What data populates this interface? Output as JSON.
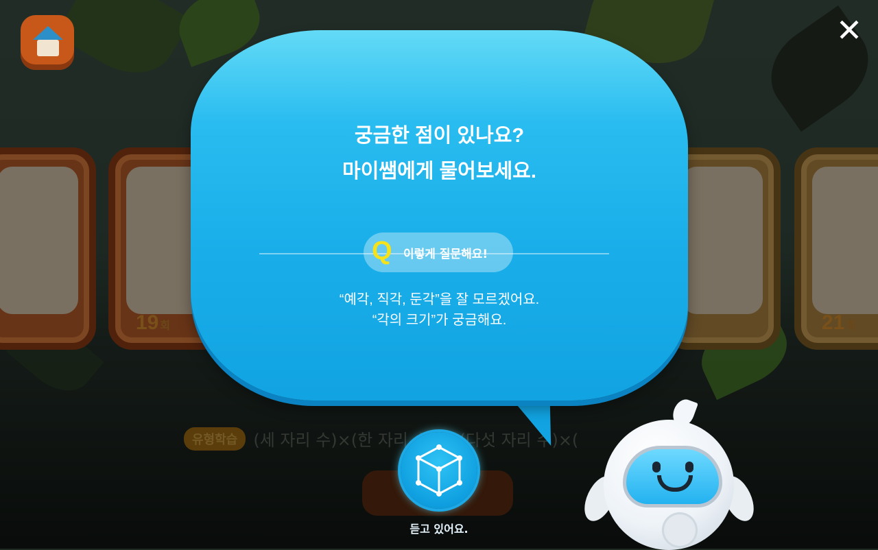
{
  "header": {
    "home_icon": "home-icon",
    "close_icon": "close-icon",
    "close_glyph": "✕"
  },
  "cards": [
    {
      "number": "",
      "unit": ""
    },
    {
      "number": "19",
      "unit": "회"
    },
    {
      "number": "",
      "unit": ""
    },
    {
      "number": "21",
      "unit": "회"
    }
  ],
  "bubble": {
    "title_line1": "궁금한 점이 있나요?",
    "title_line2": "마이쌤에게 물어보세요.",
    "q_letter": "Q",
    "q_label": "이렇게 질문해요!",
    "example_line1": "“예각, 직각, 둔각”을 잘 모르겠어요.",
    "example_line2": "“각의 크기”가 궁금해요."
  },
  "caption": {
    "tag": "유형학습",
    "math": "(세 자리 수)×(한 자리 수) ~ (다섯 자리 수)×("
  },
  "mic": {
    "icon": "cube-icon",
    "status": "듣고 있어요."
  },
  "colors": {
    "bubble": "#19aee9",
    "q_yellow": "#f5e21a",
    "card_orange": "#b45a28"
  }
}
